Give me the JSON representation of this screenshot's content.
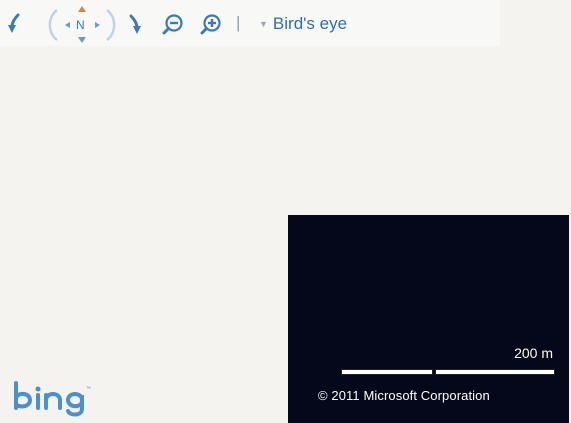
{
  "toolbar": {
    "icons": {
      "rotate_left": "rotate-left-icon",
      "compass": "compass-icon",
      "rotate_right": "rotate-right-icon",
      "zoom_out": "zoom-out-icon",
      "zoom_in": "zoom-in-icon"
    },
    "compass_label": "N",
    "separator": "|",
    "view_mode_label": "Bird's eye"
  },
  "map": {
    "scale_label": "200 m",
    "copyright": "© 2011 Microsoft Corporation",
    "logo_text": "bing"
  },
  "colors": {
    "accent": "#2f6fb0",
    "compass_north": "#e2823a",
    "map_background": "#f4f3ef",
    "aerial_background": "#05081a",
    "toolbar_background": "#f8f8f6"
  }
}
